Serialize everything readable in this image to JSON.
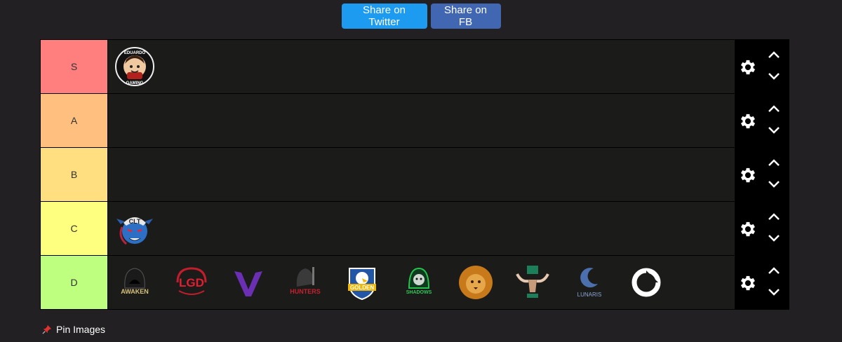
{
  "share": {
    "twitter_label": "Share on Twitter",
    "fb_label": "Share on FB"
  },
  "tiers": [
    {
      "label": "S",
      "color": "#ff7f7f",
      "items": [
        "eduardo-gaming-logo"
      ]
    },
    {
      "label": "A",
      "color": "#ffbf7f",
      "items": []
    },
    {
      "label": "B",
      "color": "#ffdf7f",
      "items": []
    },
    {
      "label": "C",
      "color": "#ffff7f",
      "items": [
        "clt-ogre-logo"
      ]
    },
    {
      "label": "D",
      "color": "#bfff7f",
      "items": [
        "awaken-gaming-logo",
        "lgd-logo",
        "purple-v-logo",
        "hunters-logo",
        "golden-eagle-logo",
        "shadows-logo",
        "lion-logo",
        "moose-logo",
        "lunaris-logo",
        "ring-logo"
      ]
    }
  ],
  "logo_text": {
    "eduardo_top": "EDUARDO",
    "eduardo_bottom": "GAMING",
    "clt": "CLT",
    "awaken": "AWAKEN",
    "lgd": "LGD",
    "hunters": "HUNTERS",
    "golden": "GOLDEN",
    "shadows": "SHADOWS",
    "lunaris": "LUNARIS"
  },
  "pin": {
    "label": "Pin Images"
  }
}
